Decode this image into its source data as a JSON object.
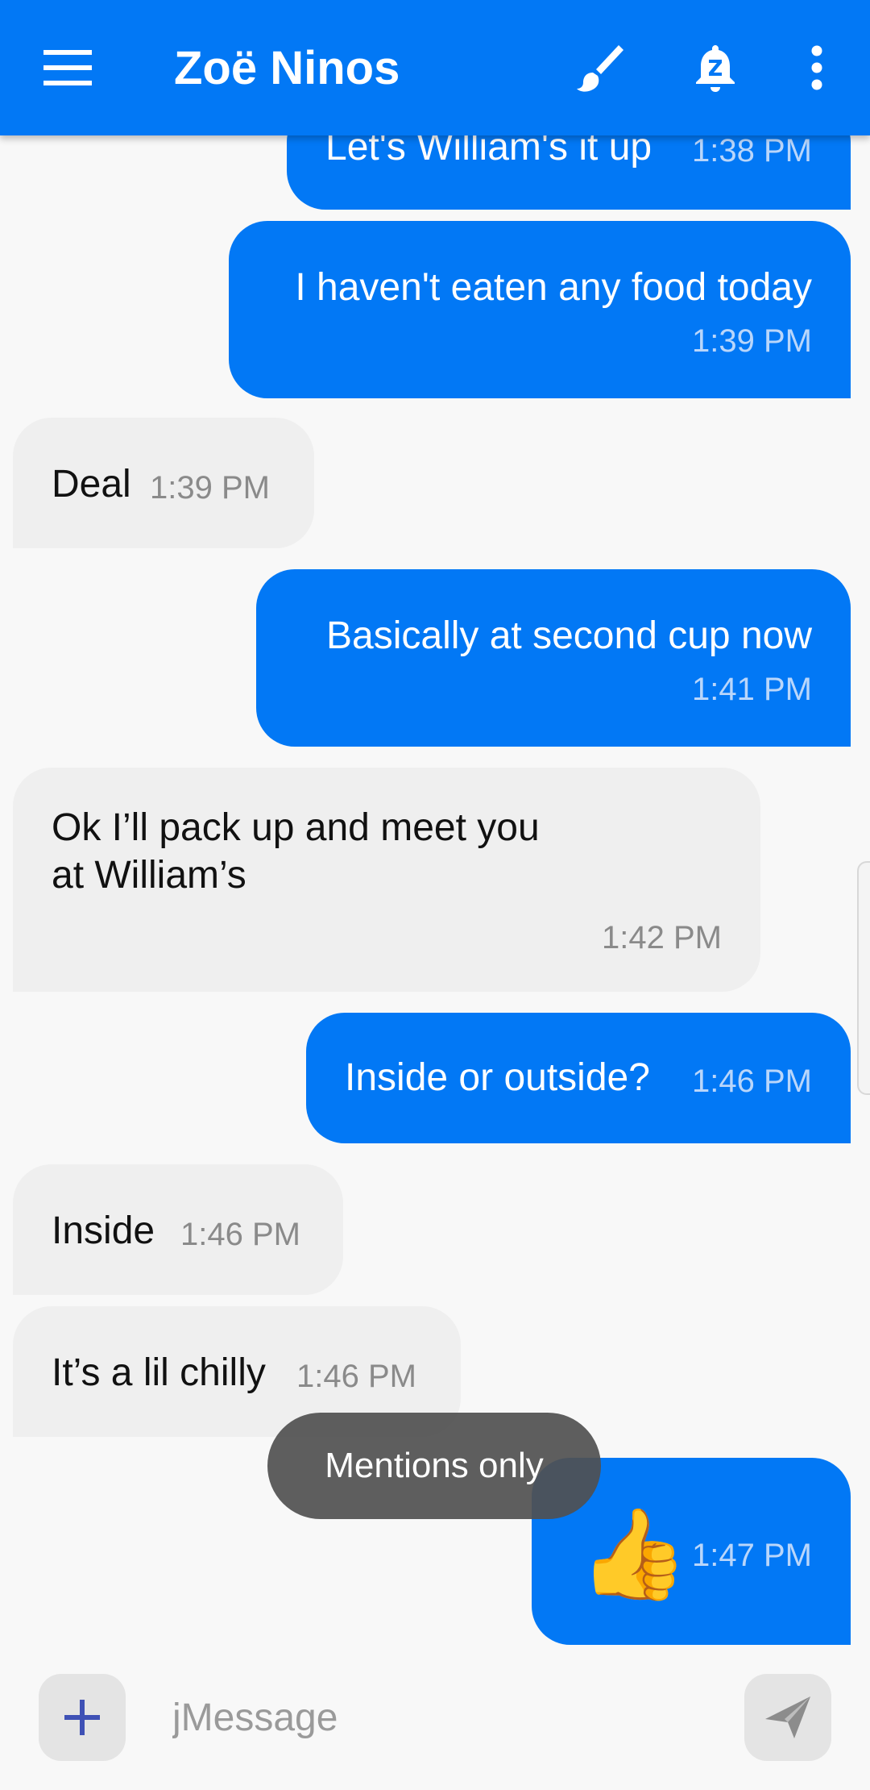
{
  "app_bar": {
    "title": "Zoë Ninos",
    "icons": [
      "menu-icon",
      "brush-icon",
      "notification-snooze-icon",
      "more-vert-icon"
    ],
    "color": "#0278f5"
  },
  "messages": [
    {
      "direction": "outgoing",
      "text": "Let's William's it up",
      "time": "1:38 PM"
    },
    {
      "direction": "outgoing",
      "text": "I haven't eaten any food today",
      "time": "1:39 PM"
    },
    {
      "direction": "incoming",
      "text": "Deal",
      "time": "1:39 PM"
    },
    {
      "direction": "outgoing",
      "text": "Basically at second cup now",
      "time": "1:41 PM"
    },
    {
      "direction": "incoming",
      "lines": [
        "Ok I’ll pack up and meet you",
        "at William’s"
      ],
      "time": "1:42 PM"
    },
    {
      "direction": "outgoing",
      "text": "Inside or outside?",
      "time": "1:46 PM"
    },
    {
      "direction": "incoming",
      "text": "Inside",
      "time": "1:46 PM"
    },
    {
      "direction": "incoming",
      "text": "It’s a lil chilly",
      "time": "1:46 PM"
    },
    {
      "direction": "outgoing",
      "emoji": "👍",
      "time": "1:47 PM"
    }
  ],
  "toast": {
    "text": "Mentions only"
  },
  "compose": {
    "placeholder": "jMessage",
    "value": "",
    "attach_icon": "plus-icon",
    "send_icon": "send-icon"
  },
  "colors": {
    "outgoing_bubble": "#0278f5",
    "incoming_bubble": "#efefef",
    "background": "#f8f8f8"
  }
}
